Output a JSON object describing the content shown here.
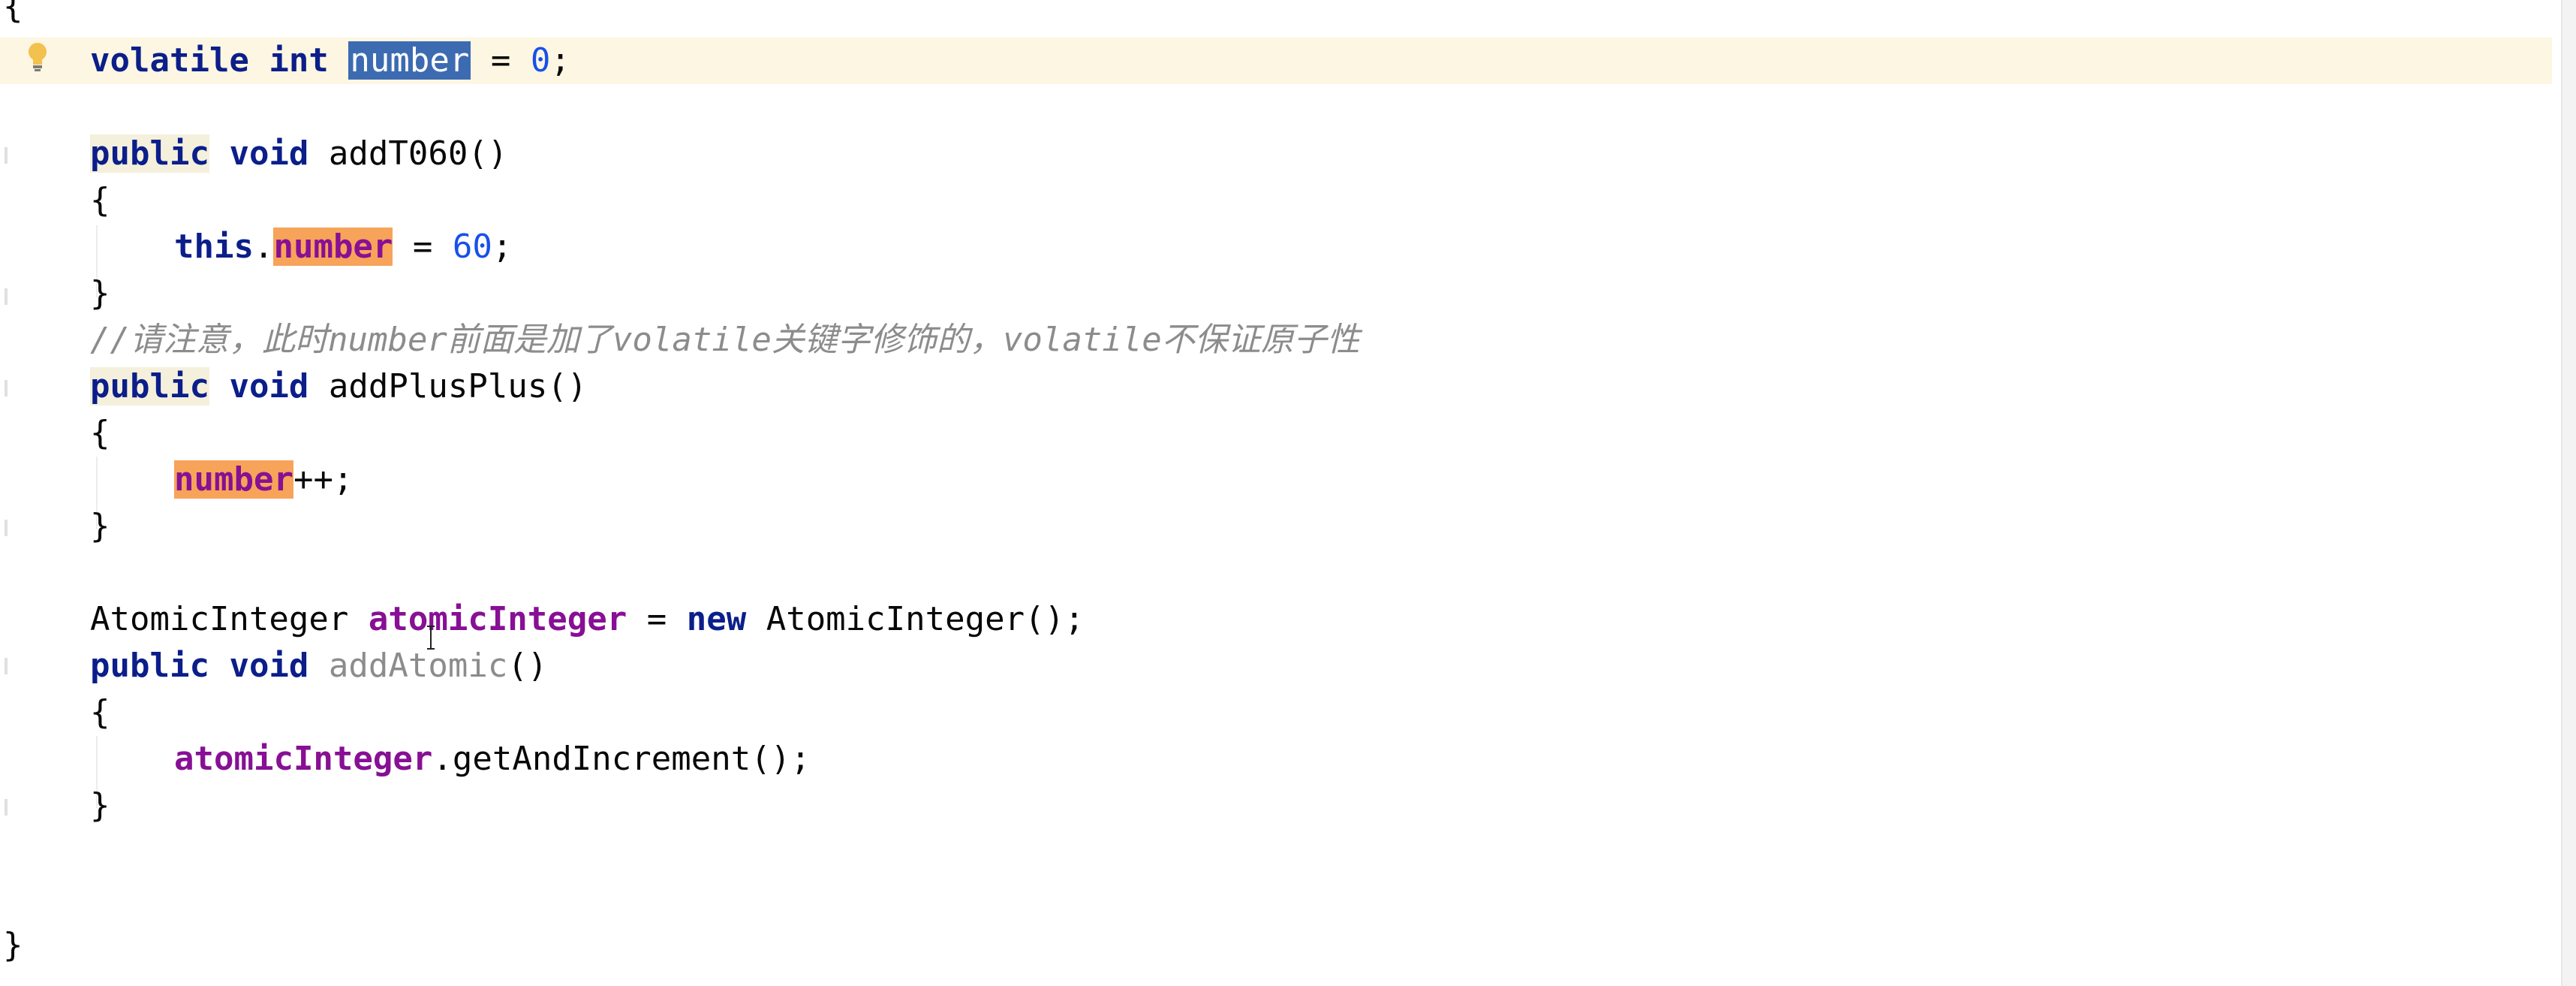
{
  "editor": {
    "lines": {
      "open_brace": "{",
      "field_decl": {
        "kw1": "volatile",
        "kw2": "int",
        "name": "number",
        "rest": " = ",
        "value": "0",
        "end": ";"
      },
      "add_t060_sig": {
        "kw1": "public",
        "kw2": "void",
        "name": " addT060()"
      },
      "brace_open_1": "{",
      "this_assign": {
        "kw": "this",
        "dot": ".",
        "field": "number",
        "rest": " = ",
        "value": "60",
        "end": ";"
      },
      "brace_close_1": "}",
      "comment": "//请注意，此时number前面是加了volatile关键字修饰的，volatile不保证原子性",
      "add_plus_sig": {
        "kw1": "public",
        "kw2": "void",
        "name": " addPlusPlus()"
      },
      "brace_open_2": "{",
      "increment": {
        "field": "number",
        "rest": "++;"
      },
      "brace_close_2": "}",
      "atomic_decl": {
        "type": "AtomicInteger ",
        "field": "atomicInteger",
        "rest1": " = ",
        "kw": "new",
        "rest2": " AtomicInteger();"
      },
      "add_atomic_sig": {
        "kw1": "public",
        "kw2": "void",
        "name": "addAtomic",
        "parens": "()"
      },
      "brace_open_3": "{",
      "atomic_call": {
        "field": "atomicInteger",
        "rest": ".getAndIncrement();"
      },
      "brace_close_3": "}",
      "close_brace": "}"
    }
  },
  "icons": {
    "bulb": "lightbulb-icon",
    "cursor": "text-cursor-icon"
  },
  "colors": {
    "keyword": "#0b1e8a",
    "field": "#871094",
    "number": "#1750eb",
    "comment": "#8c8c8c",
    "selection": "#3d6bb2",
    "usage_highlight": "#f7a35a",
    "current_line": "#fcf6e2"
  }
}
